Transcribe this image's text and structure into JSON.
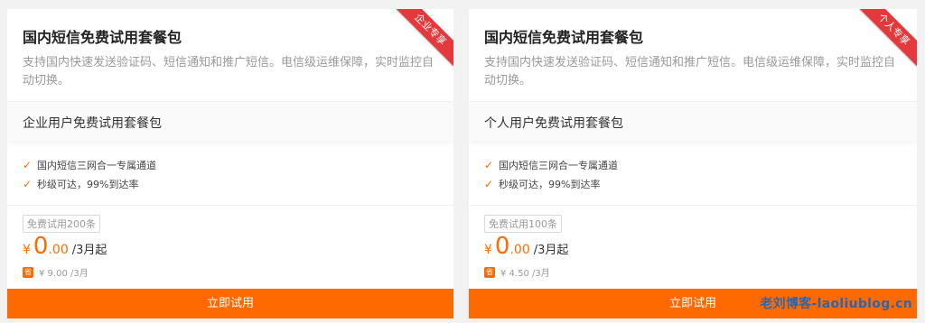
{
  "cards": [
    {
      "title": "国内短信免费试用套餐包",
      "description": "支持国内快速发送验证码、短信通知和推广短信。电信级运维保障，实时监控自动切换。",
      "ribbon": "企业专享",
      "package_name": "企业用户免费试用套餐包",
      "features": [
        "国内短信三网合一专属通道",
        "秒级可达，99%到达率"
      ],
      "trial_badge": "免费试用200条",
      "price": {
        "currency": "¥",
        "integer": "0",
        "decimal": ".00",
        "period": "/3月起"
      },
      "original_price_icon": "省",
      "original_price": "¥ 9.00 /3月",
      "button": "立即试用"
    },
    {
      "title": "国内短信免费试用套餐包",
      "description": "支持国内快速发送验证码、短信通知和推广短信。电信级运维保障，实时监控自动切换。",
      "ribbon": "个人专享",
      "package_name": "个人用户免费试用套餐包",
      "features": [
        "国内短信三网合一专属通道",
        "秒级可达，99%到达率"
      ],
      "trial_badge": "免费试用100条",
      "price": {
        "currency": "¥",
        "integer": "0",
        "decimal": ".00",
        "period": "/3月起"
      },
      "original_price_icon": "省",
      "original_price": "¥ 4.50 /3月",
      "button": "立即试用"
    }
  ],
  "watermark": "老刘博客-laoliublog.cn",
  "colors": {
    "accent": "#ff6a00",
    "ribbon": "#e4393c",
    "watermark": "#1565c0"
  }
}
